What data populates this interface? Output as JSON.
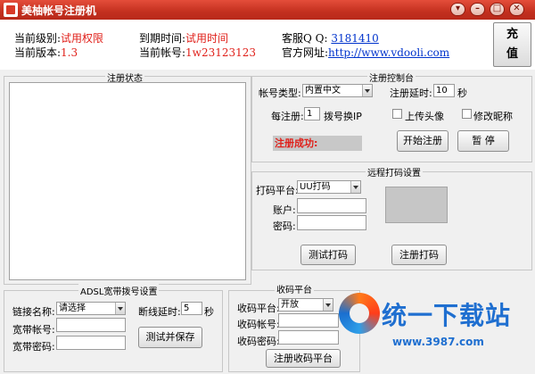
{
  "window": {
    "title": "美柚帐号注册机",
    "controls": {
      "settings": "▾",
      "minimize": "–",
      "maximize": "□",
      "close": "✕"
    }
  },
  "header": {
    "level_label": "当前级别:",
    "level_value": "试用权限",
    "version_label": "当前版本:",
    "version_value": "1.3",
    "expire_label": "到期时间:",
    "expire_value": "试用时间",
    "account_label": "当前帐号:",
    "account_value": "1w23123123",
    "qq_label": "客服Q Q:",
    "qq_value": "3181410",
    "site_label": "官方网址:",
    "site_value": "http://www.vdooli.com",
    "recharge_button": "充\n值"
  },
  "status_panel": {
    "title": "注册状态"
  },
  "register_control": {
    "title": "注册控制台",
    "account_type_label": "帐号类型:",
    "account_type_value": "内置中文",
    "delay_label": "注册延时:",
    "delay_value": "10",
    "delay_unit": "秒",
    "per_register_label": "每注册:",
    "per_register_value": "1",
    "per_register_suffix": "拨号换IP",
    "upload_avatar_label": "上传头像",
    "modify_nickname_label": "修改昵称",
    "success_text": "注册成功:",
    "start_button": "开始注册",
    "pause_button": "暂 停"
  },
  "remote_captcha": {
    "title": "远程打码设置",
    "platform_label": "打码平台:",
    "platform_value": "UU打码",
    "account_label": "账户:",
    "password_label": "密码:",
    "test_button": "测试打码",
    "register_button": "注册打码"
  },
  "adsl": {
    "title": "ADSL宽带拨号设置",
    "link_name_label": "链接名称:",
    "link_name_value": "请选择",
    "disconnect_delay_label": "断线延时:",
    "disconnect_delay_value": "5",
    "disconnect_delay_unit": "秒",
    "broadband_account_label": "宽带帐号:",
    "broadband_password_label": "宽带密码:",
    "test_save_button": "测试并保存"
  },
  "sms_platform": {
    "title": "收码平台",
    "platform_label": "收码平台:",
    "platform_value": "开放",
    "account_label": "收码帐号:",
    "password_label": "收码密码:",
    "register_button": "注册收码平台"
  },
  "watermark": {
    "text": "统一下载站",
    "url": "www.3987.com"
  }
}
